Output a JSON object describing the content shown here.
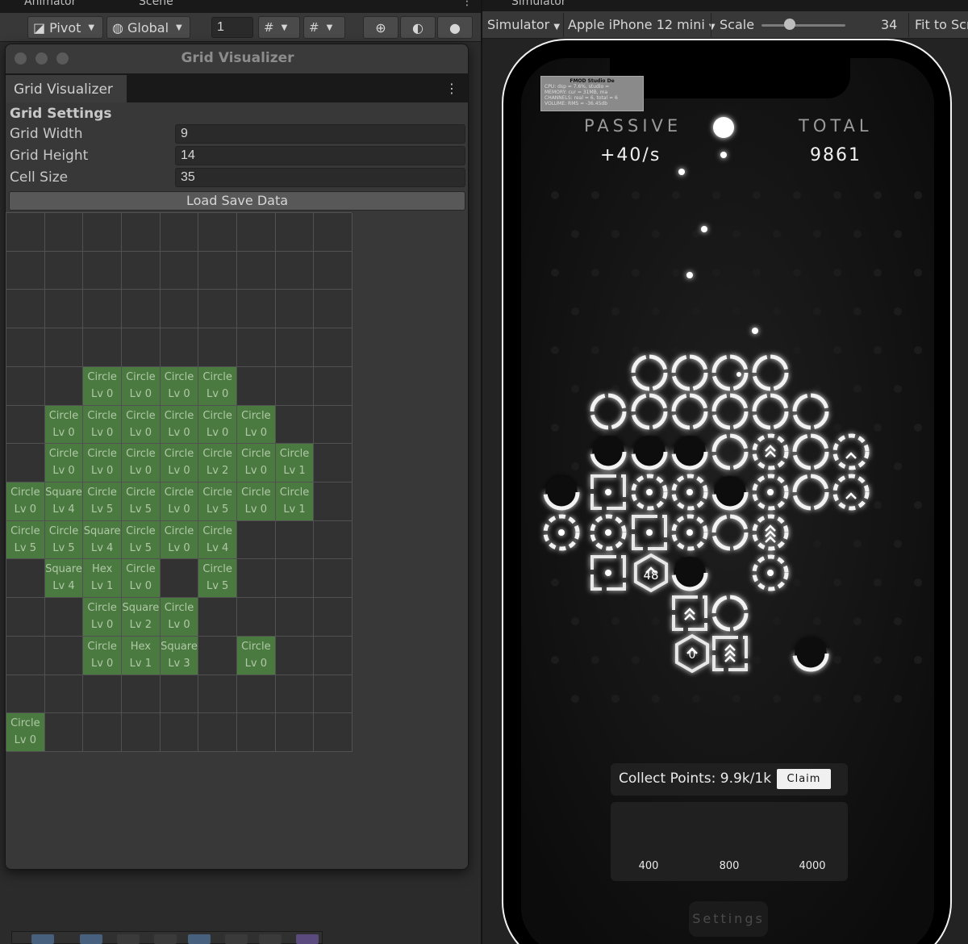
{
  "editor_tabs": {
    "animator": "Animator",
    "scene": "Scene",
    "simulator": "Simulator"
  },
  "scene_toolbar": {
    "pivot": "Pivot",
    "global": "Global",
    "snap_value": "1"
  },
  "grid_window": {
    "title": "Grid Visualizer",
    "tab": "Grid Visualizer",
    "section": "Grid Settings",
    "fields": [
      {
        "label": "Grid Width",
        "value": "9"
      },
      {
        "label": "Grid Height",
        "value": "14"
      },
      {
        "label": "Cell Size",
        "value": "35"
      }
    ],
    "load_button": "Load Save Data",
    "grid": {
      "cols": 9,
      "rows": 14,
      "cells": [
        {
          "row": 4,
          "col": 2,
          "shape": "Circle",
          "level": "Lv 0"
        },
        {
          "row": 4,
          "col": 3,
          "shape": "Circle",
          "level": "Lv 0"
        },
        {
          "row": 4,
          "col": 4,
          "shape": "Circle",
          "level": "Lv 0"
        },
        {
          "row": 4,
          "col": 5,
          "shape": "Circle",
          "level": "Lv 0"
        },
        {
          "row": 5,
          "col": 1,
          "shape": "Circle",
          "level": "Lv 0"
        },
        {
          "row": 5,
          "col": 2,
          "shape": "Circle",
          "level": "Lv 0"
        },
        {
          "row": 5,
          "col": 3,
          "shape": "Circle",
          "level": "Lv 0"
        },
        {
          "row": 5,
          "col": 4,
          "shape": "Circle",
          "level": "Lv 0"
        },
        {
          "row": 5,
          "col": 5,
          "shape": "Circle",
          "level": "Lv 0"
        },
        {
          "row": 5,
          "col": 6,
          "shape": "Circle",
          "level": "Lv 0"
        },
        {
          "row": 6,
          "col": 1,
          "shape": "Circle",
          "level": "Lv 0"
        },
        {
          "row": 6,
          "col": 2,
          "shape": "Circle",
          "level": "Lv 0"
        },
        {
          "row": 6,
          "col": 3,
          "shape": "Circle",
          "level": "Lv 0"
        },
        {
          "row": 6,
          "col": 4,
          "shape": "Circle",
          "level": "Lv 0"
        },
        {
          "row": 6,
          "col": 5,
          "shape": "Circle",
          "level": "Lv 2"
        },
        {
          "row": 6,
          "col": 6,
          "shape": "Circle",
          "level": "Lv 0"
        },
        {
          "row": 6,
          "col": 7,
          "shape": "Circle",
          "level": "Lv 1"
        },
        {
          "row": 7,
          "col": 0,
          "shape": "Circle",
          "level": "Lv 0"
        },
        {
          "row": 7,
          "col": 1,
          "shape": "Square",
          "level": "Lv 4"
        },
        {
          "row": 7,
          "col": 2,
          "shape": "Circle",
          "level": "Lv 5"
        },
        {
          "row": 7,
          "col": 3,
          "shape": "Circle",
          "level": "Lv 5"
        },
        {
          "row": 7,
          "col": 4,
          "shape": "Circle",
          "level": "Lv 0"
        },
        {
          "row": 7,
          "col": 5,
          "shape": "Circle",
          "level": "Lv 5"
        },
        {
          "row": 7,
          "col": 6,
          "shape": "Circle",
          "level": "Lv 0"
        },
        {
          "row": 7,
          "col": 7,
          "shape": "Circle",
          "level": "Lv 1"
        },
        {
          "row": 8,
          "col": 0,
          "shape": "Circle",
          "level": "Lv 5"
        },
        {
          "row": 8,
          "col": 1,
          "shape": "Circle",
          "level": "Lv 5"
        },
        {
          "row": 8,
          "col": 2,
          "shape": "Square",
          "level": "Lv 4"
        },
        {
          "row": 8,
          "col": 3,
          "shape": "Circle",
          "level": "Lv 5"
        },
        {
          "row": 8,
          "col": 4,
          "shape": "Circle",
          "level": "Lv 0"
        },
        {
          "row": 8,
          "col": 5,
          "shape": "Circle",
          "level": "Lv 4"
        },
        {
          "row": 9,
          "col": 1,
          "shape": "Square",
          "level": "Lv 4"
        },
        {
          "row": 9,
          "col": 2,
          "shape": "Hex",
          "level": "Lv 1"
        },
        {
          "row": 9,
          "col": 3,
          "shape": "Circle",
          "level": "Lv 0"
        },
        {
          "row": 9,
          "col": 5,
          "shape": "Circle",
          "level": "Lv 5"
        },
        {
          "row": 10,
          "col": 2,
          "shape": "Circle",
          "level": "Lv 0"
        },
        {
          "row": 10,
          "col": 3,
          "shape": "Square",
          "level": "Lv 2"
        },
        {
          "row": 10,
          "col": 4,
          "shape": "Circle",
          "level": "Lv 0"
        },
        {
          "row": 11,
          "col": 2,
          "shape": "Circle",
          "level": "Lv 0"
        },
        {
          "row": 11,
          "col": 3,
          "shape": "Hex",
          "level": "Lv 1"
        },
        {
          "row": 11,
          "col": 4,
          "shape": "Square",
          "level": "Lv 3"
        },
        {
          "row": 11,
          "col": 6,
          "shape": "Circle",
          "level": "Lv 0"
        },
        {
          "row": 13,
          "col": 0,
          "shape": "Circle",
          "level": "Lv 0"
        }
      ]
    }
  },
  "simulator_toolbar": {
    "mode": "Simulator",
    "device": "Apple iPhone 12 mini",
    "scale_label": "Scale",
    "scale_value": 34,
    "scale_fraction": 0.34,
    "fit": "Fit to Screen"
  },
  "fmod_overlay": {
    "title": "FMOD Studio De",
    "lines": [
      "CPU: dsp = 7.6%, studio =",
      "MEMORY: cur = 31MB, ma",
      "CHANNELS: real = 6, total = 6",
      "VOLUME: RMS = -36.45db"
    ]
  },
  "hud": {
    "passive_label": "PASSIVE",
    "passive_value": "+40/s",
    "total_label": "TOTAL",
    "total_value": "9861"
  },
  "collect": {
    "label": "Collect Points: 9.9k/1k",
    "claim": "Claim"
  },
  "shop": [
    {
      "shape": "circle",
      "price": "400"
    },
    {
      "shape": "square",
      "price": "800"
    },
    {
      "shape": "hexagon",
      "price": "4000"
    }
  ],
  "settings_button": "Settings",
  "hex_labels": {
    "hex_a": "48",
    "hex_b": "0"
  },
  "colors": {
    "grid_filled": "#4a7a3f",
    "editor_bg": "#383838",
    "phone_frame": "#f2f2f2"
  }
}
